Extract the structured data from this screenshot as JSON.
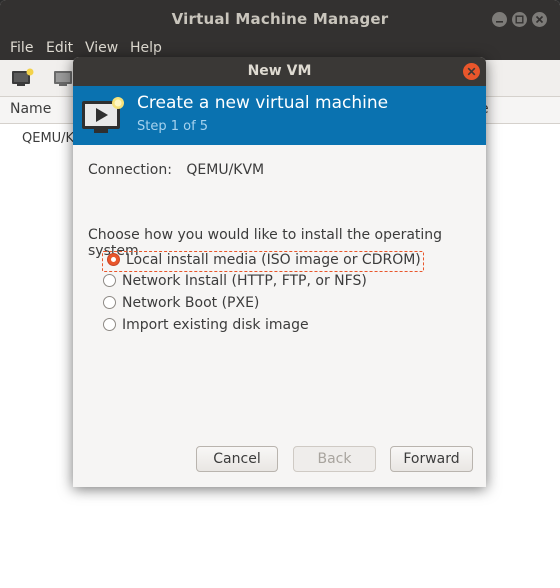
{
  "main_window": {
    "title": "Virtual Machine Manager",
    "menu": [
      "File",
      "Edit",
      "View",
      "Help"
    ],
    "toolbar_icons": [
      "new-vm-icon",
      "open-console-icon"
    ],
    "list": {
      "column_name": "Name",
      "column_right_partial": "e",
      "connection": "QEMU/KV"
    }
  },
  "dialog": {
    "title": "New VM",
    "banner": {
      "title": "Create a new virtual machine",
      "step": "Step 1 of 5"
    },
    "connection_label": "Connection:",
    "connection_value": "QEMU/KVM",
    "choose_label": "Choose how you would like to install the operating system",
    "options": [
      {
        "label": "Local install media (ISO image or CDROM)",
        "checked": true
      },
      {
        "label": "Network Install (HTTP, FTP, or NFS)",
        "checked": false
      },
      {
        "label": "Network Boot (PXE)",
        "checked": false
      },
      {
        "label": "Import existing disk image",
        "checked": false
      }
    ],
    "buttons": {
      "cancel": "Cancel",
      "back": "Back",
      "forward": "Forward"
    }
  },
  "colors": {
    "banner": "#0a72b0",
    "accent": "#e9562b"
  }
}
